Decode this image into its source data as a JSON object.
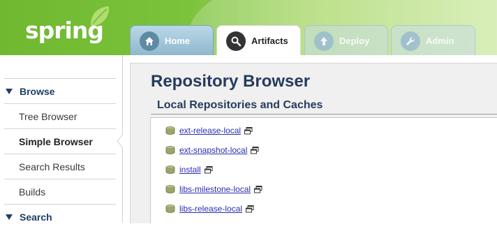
{
  "header": {
    "logo_text": "spring",
    "tabs": [
      {
        "label": "Home",
        "icon": "home-icon"
      },
      {
        "label": "Artifacts",
        "icon": "search-icon"
      },
      {
        "label": "Deploy",
        "icon": "upload-icon"
      },
      {
        "label": "Admin",
        "icon": "wrench-icon"
      }
    ],
    "colors": {
      "brand_green": "#6fb82f",
      "tab_blue": "#8fb7cc"
    }
  },
  "sidebar": {
    "sections": [
      {
        "label": "Browse",
        "items": [
          "Tree Browser",
          "Simple Browser",
          "Search Results",
          "Builds"
        ]
      },
      {
        "label": "Search"
      }
    ],
    "active_item": "Simple Browser"
  },
  "main": {
    "title": "Repository Browser",
    "section_title": "Local Repositories and Caches",
    "repositories": [
      "ext-release-local",
      "ext-snapshot-local",
      "install",
      "libs-milestone-local",
      "libs-release-local"
    ],
    "colors": {
      "title": "#263b5e",
      "link": "#2a2fb0"
    }
  }
}
